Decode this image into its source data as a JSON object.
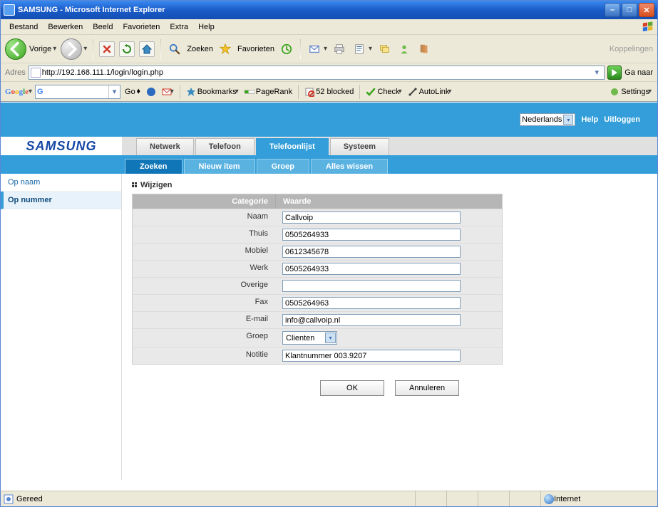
{
  "window": {
    "title": "SAMSUNG - Microsoft Internet Explorer"
  },
  "menubar": {
    "bestand": "Bestand",
    "bewerken": "Bewerken",
    "beeld": "Beeld",
    "favorieten": "Favorieten",
    "extra": "Extra",
    "help": "Help"
  },
  "ietoolbar": {
    "vorige": "Vorige",
    "zoeken": "Zoeken",
    "favorieten": "Favorieten",
    "koppelingen": "Koppelingen"
  },
  "addressbar": {
    "label": "Adres",
    "url": "http://192.168.111.1/login/login.php",
    "go": "Ga naar"
  },
  "googlebar": {
    "brand": "Google",
    "go": "Go",
    "bookmarks": "Bookmarks",
    "pagerank": "PageRank",
    "blocked": "52 blocked",
    "check": "Check",
    "autolink": "AutoLink",
    "settings": "Settings"
  },
  "samsungheader": {
    "language": "Nederlands",
    "help": "Help",
    "logout": "Uitloggen"
  },
  "logo": "SAMSUNG",
  "ptabs": {
    "netwerk": "Netwerk",
    "telefoon": "Telefoon",
    "telefoonlijst": "Telefoonlijst",
    "systeem": "Systeem"
  },
  "subtabs": {
    "zoeken": "Zoeken",
    "nieuwitem": "Nieuw item",
    "groep": "Groep",
    "alleswissen": "Alles wissen"
  },
  "sidemenu": {
    "opnaam": "Op naam",
    "opnummer": "Op nummer"
  },
  "section": {
    "title": "Wijzigen"
  },
  "form": {
    "header_cat": "Categorie",
    "header_val": "Waarde",
    "rows": {
      "naam": {
        "label": "Naam",
        "value": "Callvoip"
      },
      "thuis": {
        "label": "Thuis",
        "value": "0505264933"
      },
      "mobiel": {
        "label": "Mobiel",
        "value": "0612345678"
      },
      "werk": {
        "label": "Werk",
        "value": "0505264933"
      },
      "overige": {
        "label": "Overige",
        "value": ""
      },
      "fax": {
        "label": "Fax",
        "value": "0505264963"
      },
      "email": {
        "label": "E-mail",
        "value": "info@callvoip.nl"
      },
      "groep": {
        "label": "Groep",
        "value": "Clienten"
      },
      "notitie": {
        "label": "Notitie",
        "value": "Klantnummer 003.9207"
      }
    }
  },
  "actions": {
    "ok": "OK",
    "annuleren": "Annuleren"
  },
  "statusbar": {
    "status": "Gereed",
    "zone": "Internet"
  }
}
